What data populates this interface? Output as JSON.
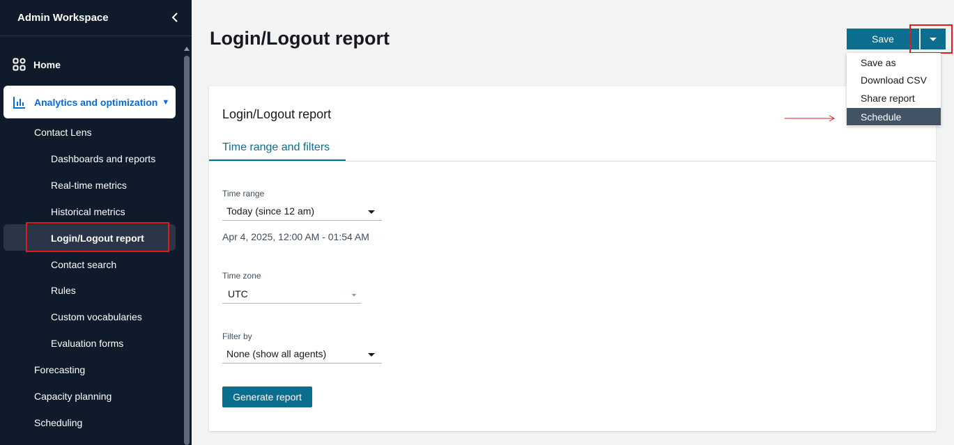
{
  "sidebar": {
    "title": "Admin Workspace",
    "home": "Home",
    "analytics": "Analytics and optimization",
    "contact_lens": "Contact Lens",
    "sub_items": [
      "Dashboards and reports",
      "Real-time metrics",
      "Historical metrics",
      "Login/Logout report",
      "Contact search",
      "Rules",
      "Custom vocabularies",
      "Evaluation forms"
    ],
    "other_items": [
      "Forecasting",
      "Capacity planning",
      "Scheduling"
    ]
  },
  "header": {
    "title": "Login/Logout report",
    "save_label": "Save"
  },
  "save_menu": {
    "items": [
      "Save as",
      "Download CSV",
      "Share report",
      "Schedule"
    ],
    "selected": "Schedule"
  },
  "card": {
    "title": "Login/Logout report",
    "tab": "Time range and filters",
    "time_range": {
      "label": "Time range",
      "value": "Today (since 12 am)",
      "range_text": "Apr 4, 2025, 12:00 AM - 01:54 AM"
    },
    "time_zone": {
      "label": "Time zone",
      "value": "UTC"
    },
    "filter_by": {
      "label": "Filter by",
      "value": "None (show all agents)"
    },
    "generate_label": "Generate report"
  },
  "colors": {
    "sidebar_bg": "#0f1b2a",
    "primary": "#0b6e8e",
    "highlight": "#e41b1b",
    "menu_selected": "#435366"
  }
}
